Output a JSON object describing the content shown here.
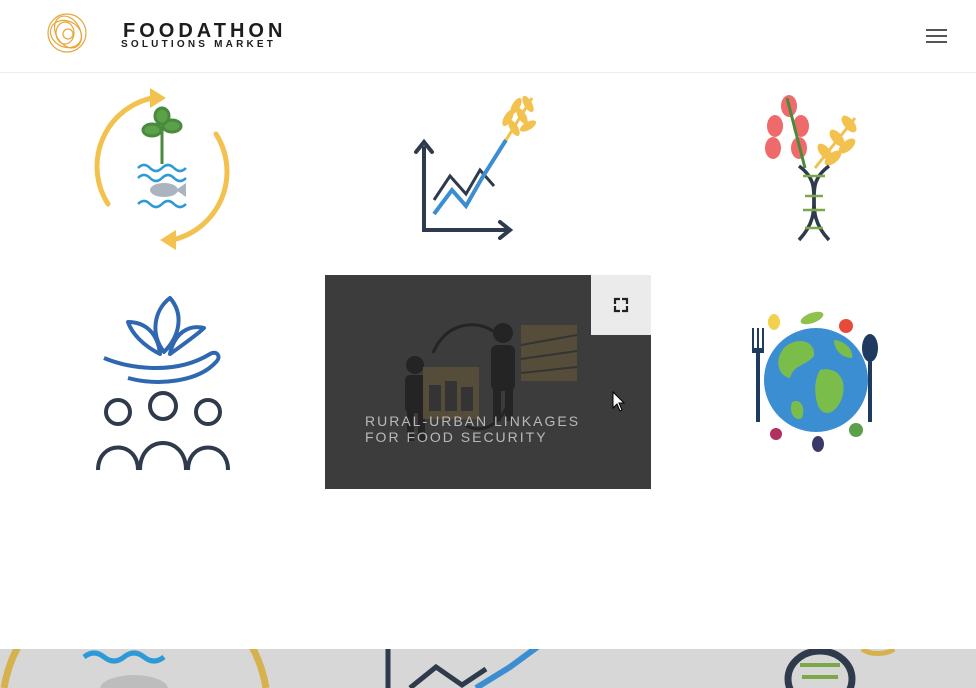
{
  "header": {
    "brand_name": "FOODATHON",
    "brand_tagline": "SOLUTIONS MARKET",
    "logo_icon": "circular-scribble-logo",
    "menu_icon": "hamburger-menu-icon"
  },
  "grid": {
    "active_tile_title": "RURAL-URBAN LINKAGES FOR FOOD SECURITY",
    "active_tile_title_line1": "RURAL-URBAN LINKAGES",
    "active_tile_title_line2": "FOR FOOD SECURITY",
    "expand_icon": "fullscreen-expand-icon",
    "tiles": [
      {
        "icon": "aquaponics-cycle-icon"
      },
      {
        "icon": "growth-chart-wheat-icon"
      },
      {
        "icon": "dna-plant-icon"
      },
      {
        "icon": "community-hand-plant-icon"
      },
      {
        "icon": "rural-urban-cycle-icon"
      },
      {
        "icon": "globe-food-cutlery-icon"
      }
    ]
  },
  "colors": {
    "accent_gold": "#f2c14e",
    "navy": "#1f3a5f",
    "blue": "#3b8ed1",
    "overlay": "#3c3c3c"
  }
}
